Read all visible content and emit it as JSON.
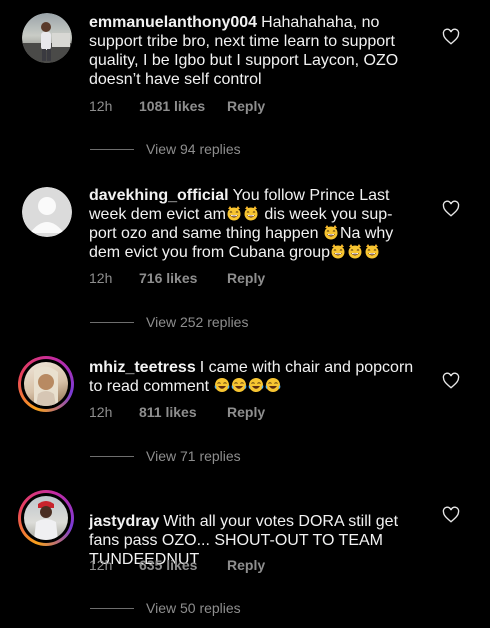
{
  "comments": [
    {
      "username": "emmanuelanthony004",
      "text_lines": [
        "Hahahahaha, no",
        "support tribe bro, next time learn to support",
        "quality, I be Igbo but I support Laycon, OZO",
        "doesn’t have self control"
      ],
      "time": "12h",
      "likes": "1081 likes",
      "reply": "Reply",
      "view_replies": "View 94 replies",
      "avatar": "photo-man-standing",
      "liked": false
    },
    {
      "username": "davekhing_official",
      "text_lines": [
        "You follow Prince Last",
        "week dem evict am",
        "dis week you sup-",
        "port ozo and same thing happen",
        "Na why",
        "dem evict you from Cubana group"
      ],
      "time": "12h",
      "likes": "716 likes",
      "reply": "Reply",
      "view_replies": "View 252 replies",
      "avatar": "default-user",
      "liked": false
    },
    {
      "username": "mhiz_teetress",
      "text_lines": [
        "I came with chair and popcorn",
        "to read comment"
      ],
      "time": "12h",
      "likes": "811 likes",
      "reply": "Reply",
      "view_replies": "View 71 replies",
      "avatar": "photo-woman",
      "liked": false
    },
    {
      "username": "jastydray",
      "text_lines": [
        "With all your votes DORA still get",
        "fans pass OZO... SHOUT-OUT TO TEAM",
        "TUNDEEDNUT"
      ],
      "time": "12h",
      "likes": "635 likes",
      "reply": "Reply",
      "view_replies": "View 50 replies",
      "avatar": "photo-man-red-cap",
      "liked": false
    }
  ],
  "icons": {
    "heart": "heart-outline-icon",
    "emoji_cat": "grinning-cat-emoji",
    "emoji_laugh": "tears-of-joy-emoji"
  },
  "colors": {
    "background": "#000000",
    "text": "#f2f2f2",
    "muted": "#8e8e8e",
    "story_ring": "#e8405b"
  }
}
